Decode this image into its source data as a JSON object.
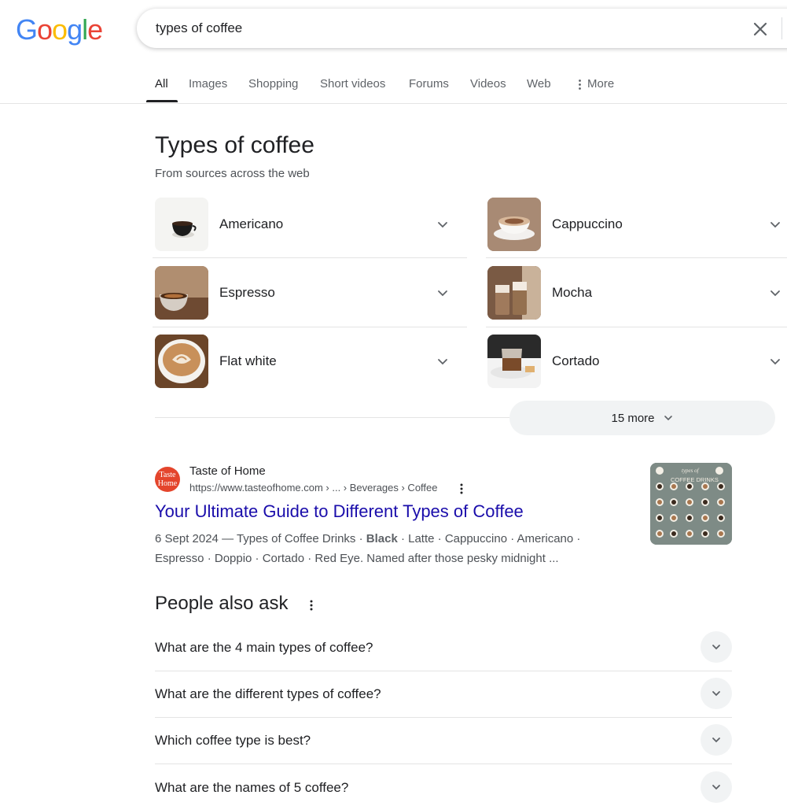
{
  "logo": {
    "letters": [
      "G",
      "o",
      "o",
      "g",
      "l",
      "e"
    ],
    "colors": [
      "#4285F4",
      "#EA4335",
      "#FBBC05",
      "#4285F4",
      "#34A853",
      "#EA4335"
    ]
  },
  "search": {
    "query": "types of coffee"
  },
  "tabs": [
    {
      "label": "All",
      "active": true
    },
    {
      "label": "Images"
    },
    {
      "label": "Shopping"
    },
    {
      "label": "Short videos"
    },
    {
      "label": "Forums"
    },
    {
      "label": "Videos"
    },
    {
      "label": "Web"
    },
    {
      "label": "More"
    }
  ],
  "carousel": {
    "title": "Types of coffee",
    "subtitle": "From sources across the web",
    "items": [
      {
        "label": "Americano"
      },
      {
        "label": "Cappuccino"
      },
      {
        "label": "Espresso"
      },
      {
        "label": "Mocha"
      },
      {
        "label": "Flat white"
      },
      {
        "label": "Cortado"
      }
    ],
    "more_label": "15 more"
  },
  "result": {
    "favicon_text": "Taste Home",
    "site_name": "Taste of Home",
    "url": "https://www.tasteofhome.com › ... › Beverages › Coffee",
    "title": "Your Ultimate Guide to Different Types of Coffee",
    "snippet_prefix": "6 Sept 2024 — Types of Coffee Drinks · ",
    "snippet_bold": "Black",
    "snippet_suffix": " · Latte · Cappuccino · Americano · Espresso · Doppio · Cortado · Red Eye. Named after those pesky midnight ...",
    "thumb_title_small": "types of",
    "thumb_title": "COFFEE DRINKS"
  },
  "paa": {
    "title": "People also ask",
    "questions": [
      "What are the 4 main types of coffee?",
      "What are the different types of coffee?",
      "Which coffee type is best?",
      "What are the names of 5 coffee?"
    ]
  },
  "colors": {
    "link": "#1a0dab",
    "text": "#202124",
    "muted": "#4d5156"
  }
}
